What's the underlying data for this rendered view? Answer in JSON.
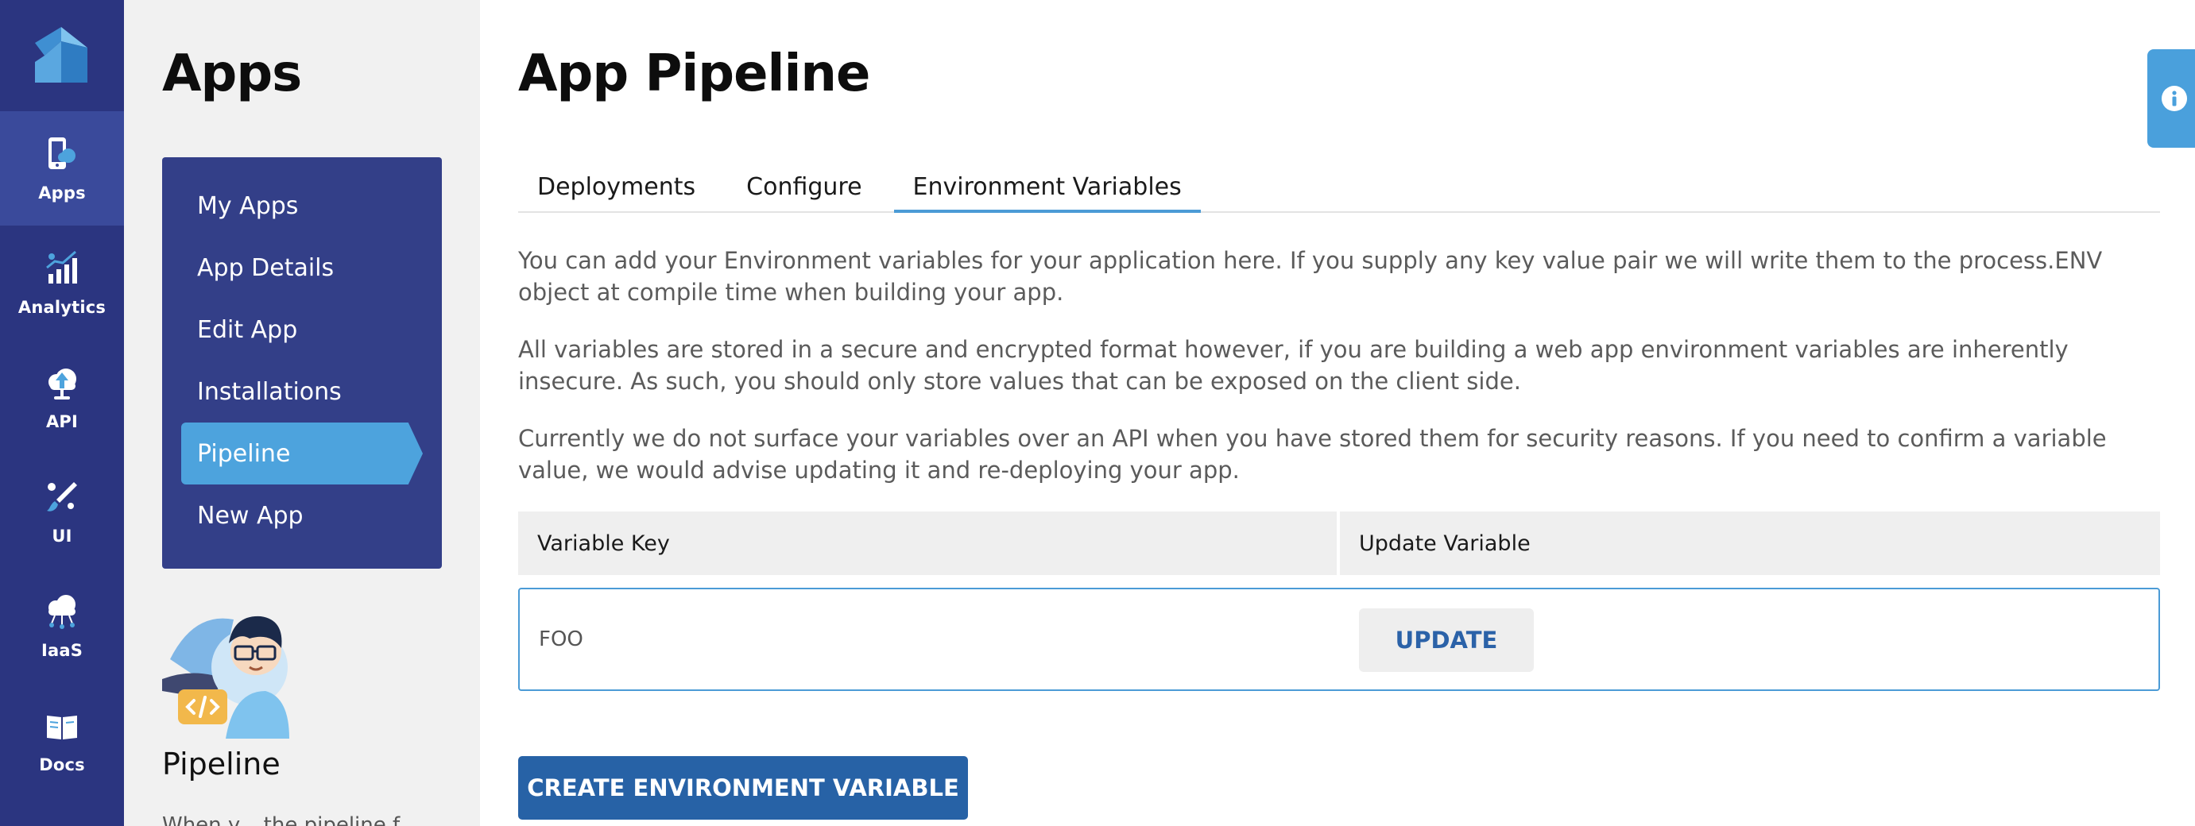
{
  "rail": {
    "items": [
      {
        "label": "Apps",
        "icon": "mobile-app-icon",
        "active": true
      },
      {
        "label": "Analytics",
        "icon": "analytics-chart-icon",
        "active": false
      },
      {
        "label": "API",
        "icon": "cloud-upload-icon",
        "active": false
      },
      {
        "label": "UI",
        "icon": "paint-brush-icon",
        "active": false
      },
      {
        "label": "IaaS",
        "icon": "cloud-network-icon",
        "active": false
      },
      {
        "label": "Docs",
        "icon": "book-icon",
        "active": false
      }
    ]
  },
  "sidebar": {
    "title": "Apps",
    "items": [
      {
        "label": "My Apps"
      },
      {
        "label": "App Details"
      },
      {
        "label": "Edit App"
      },
      {
        "label": "Installations"
      },
      {
        "label": "Pipeline",
        "active": true
      },
      {
        "label": "New App"
      }
    ],
    "caption": "Pipeline",
    "description": "When y... the pipeline f..."
  },
  "main": {
    "title": "App Pipeline",
    "tabs": [
      {
        "label": "Deployments"
      },
      {
        "label": "Configure"
      },
      {
        "label": "Environment Variables",
        "active": true
      }
    ],
    "paragraphs": [
      "You can add your Environment variables for your application here. If you supply any key value pair we will write them to the process.ENV object at compile time when building your app.",
      "All variables are stored in a secure and encrypted format however, if you are building a web app environment variables are inherently insecure. As such, you should only store values that can be exposed on the client side.",
      "Currently we do not surface your variables over an API when you have stored them for security reasons. If you need to confirm a variable value, we would advise updating it and re-deploying your app."
    ],
    "table": {
      "headers": [
        "Variable Key",
        "Update Variable"
      ],
      "rows": [
        {
          "key": "FOO",
          "action": "UPDATE"
        }
      ]
    },
    "create_button": "CREATE ENVIRONMENT VARIABLE"
  },
  "colors": {
    "rail_bg": "#2b3580",
    "menu_bg": "#333f88",
    "accent": "#4da3dd",
    "primary_button": "#2762a6"
  }
}
